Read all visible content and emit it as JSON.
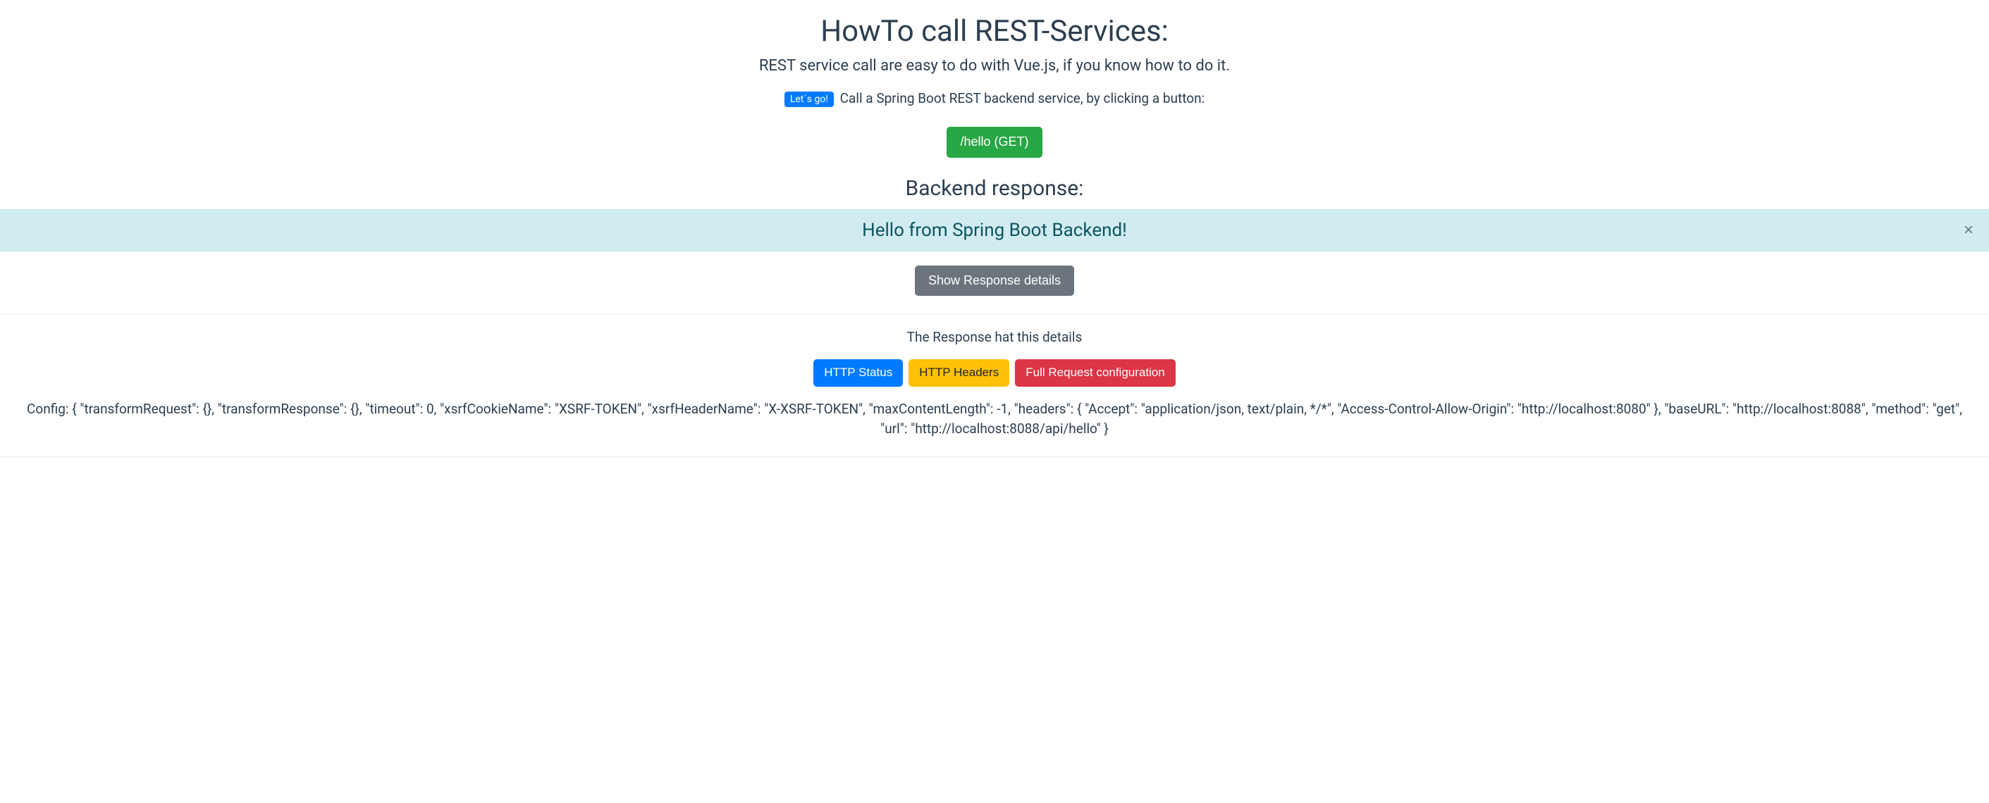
{
  "header": {
    "title": "HowTo call REST-Services:",
    "subtitle": "REST service call are easy to do with Vue.js, if you know how to do it."
  },
  "intro": {
    "badge": "Let´s go!",
    "text": "Call a Spring Boot REST backend service, by clicking a button:"
  },
  "call_button": "/hello (GET)",
  "response": {
    "heading": "Backend response:",
    "message": "Hello from Spring Boot Backend!",
    "close_symbol": "×"
  },
  "details_toggle": "Show Response details",
  "details": {
    "title": "The Response hat this details",
    "tabs": {
      "status": "HTTP Status",
      "headers": "HTTP Headers",
      "config": "Full Request configuration"
    },
    "config_text": "Config: { \"transformRequest\": {}, \"transformResponse\": {}, \"timeout\": 0, \"xsrfCookieName\": \"XSRF-TOKEN\", \"xsrfHeaderName\": \"X-XSRF-TOKEN\", \"maxContentLength\": -1, \"headers\": { \"Accept\": \"application/json, text/plain, */*\", \"Access-Control-Allow-Origin\": \"http://localhost:8080\" }, \"baseURL\": \"http://localhost:8088\", \"method\": \"get\", \"url\": \"http://localhost:8088/api/hello\" }"
  }
}
